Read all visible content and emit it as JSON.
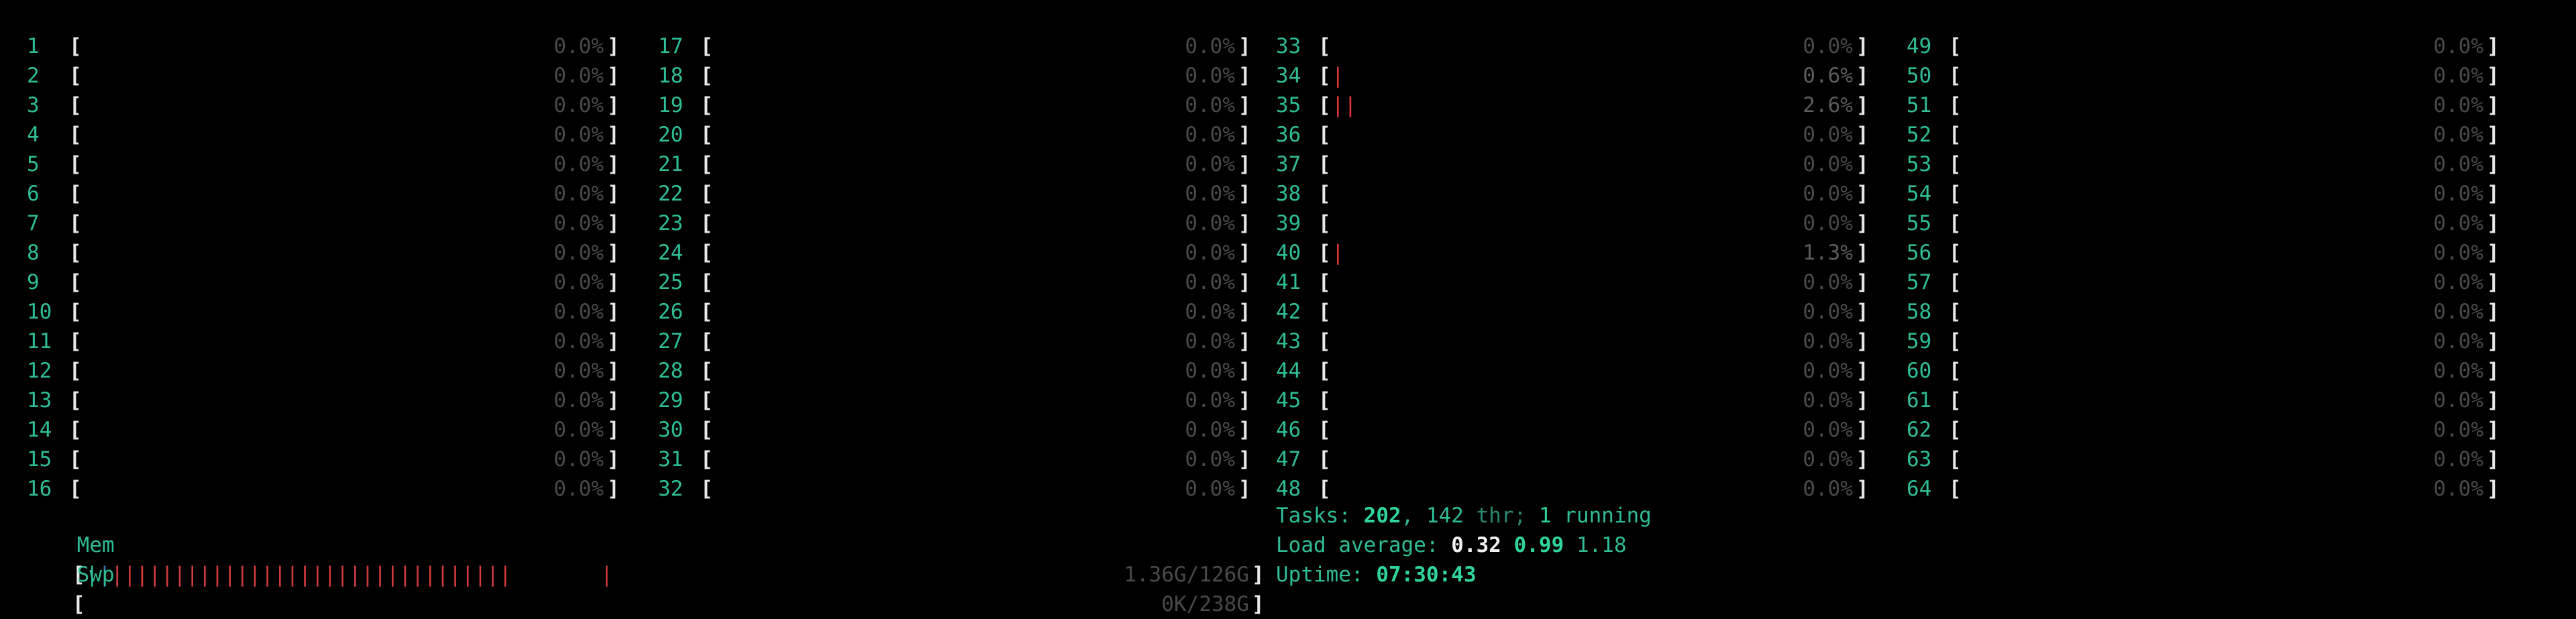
{
  "cpus": [
    {
      "id": "1",
      "pct": "0.0%",
      "bar": ""
    },
    {
      "id": "2",
      "pct": "0.0%",
      "bar": ""
    },
    {
      "id": "3",
      "pct": "0.0%",
      "bar": ""
    },
    {
      "id": "4",
      "pct": "0.0%",
      "bar": ""
    },
    {
      "id": "5",
      "pct": "0.0%",
      "bar": ""
    },
    {
      "id": "6",
      "pct": "0.0%",
      "bar": ""
    },
    {
      "id": "7",
      "pct": "0.0%",
      "bar": ""
    },
    {
      "id": "8",
      "pct": "0.0%",
      "bar": ""
    },
    {
      "id": "9",
      "pct": "0.0%",
      "bar": ""
    },
    {
      "id": "10",
      "pct": "0.0%",
      "bar": ""
    },
    {
      "id": "11",
      "pct": "0.0%",
      "bar": ""
    },
    {
      "id": "12",
      "pct": "0.0%",
      "bar": ""
    },
    {
      "id": "13",
      "pct": "0.0%",
      "bar": ""
    },
    {
      "id": "14",
      "pct": "0.0%",
      "bar": ""
    },
    {
      "id": "15",
      "pct": "0.0%",
      "bar": ""
    },
    {
      "id": "16",
      "pct": "0.0%",
      "bar": ""
    },
    {
      "id": "17",
      "pct": "0.0%",
      "bar": ""
    },
    {
      "id": "18",
      "pct": "0.0%",
      "bar": ""
    },
    {
      "id": "19",
      "pct": "0.0%",
      "bar": ""
    },
    {
      "id": "20",
      "pct": "0.0%",
      "bar": ""
    },
    {
      "id": "21",
      "pct": "0.0%",
      "bar": ""
    },
    {
      "id": "22",
      "pct": "0.0%",
      "bar": ""
    },
    {
      "id": "23",
      "pct": "0.0%",
      "bar": ""
    },
    {
      "id": "24",
      "pct": "0.0%",
      "bar": ""
    },
    {
      "id": "25",
      "pct": "0.0%",
      "bar": ""
    },
    {
      "id": "26",
      "pct": "0.0%",
      "bar": ""
    },
    {
      "id": "27",
      "pct": "0.0%",
      "bar": ""
    },
    {
      "id": "28",
      "pct": "0.0%",
      "bar": ""
    },
    {
      "id": "29",
      "pct": "0.0%",
      "bar": ""
    },
    {
      "id": "30",
      "pct": "0.0%",
      "bar": ""
    },
    {
      "id": "31",
      "pct": "0.0%",
      "bar": ""
    },
    {
      "id": "32",
      "pct": "0.0%",
      "bar": ""
    },
    {
      "id": "33",
      "pct": "0.0%",
      "bar": ""
    },
    {
      "id": "34",
      "pct": "0.6%",
      "bar": "|"
    },
    {
      "id": "35",
      "pct": "2.6%",
      "bar": "||"
    },
    {
      "id": "36",
      "pct": "0.0%",
      "bar": ""
    },
    {
      "id": "37",
      "pct": "0.0%",
      "bar": ""
    },
    {
      "id": "38",
      "pct": "0.0%",
      "bar": ""
    },
    {
      "id": "39",
      "pct": "0.0%",
      "bar": ""
    },
    {
      "id": "40",
      "pct": "1.3%",
      "bar": "|"
    },
    {
      "id": "41",
      "pct": "0.0%",
      "bar": ""
    },
    {
      "id": "42",
      "pct": "0.0%",
      "bar": ""
    },
    {
      "id": "43",
      "pct": "0.0%",
      "bar": ""
    },
    {
      "id": "44",
      "pct": "0.0%",
      "bar": ""
    },
    {
      "id": "45",
      "pct": "0.0%",
      "bar": ""
    },
    {
      "id": "46",
      "pct": "0.0%",
      "bar": ""
    },
    {
      "id": "47",
      "pct": "0.0%",
      "bar": ""
    },
    {
      "id": "48",
      "pct": "0.0%",
      "bar": ""
    },
    {
      "id": "49",
      "pct": "0.0%",
      "bar": ""
    },
    {
      "id": "50",
      "pct": "0.0%",
      "bar": ""
    },
    {
      "id": "51",
      "pct": "0.0%",
      "bar": ""
    },
    {
      "id": "52",
      "pct": "0.0%",
      "bar": ""
    },
    {
      "id": "53",
      "pct": "0.0%",
      "bar": ""
    },
    {
      "id": "54",
      "pct": "0.0%",
      "bar": ""
    },
    {
      "id": "55",
      "pct": "0.0%",
      "bar": ""
    },
    {
      "id": "56",
      "pct": "0.0%",
      "bar": ""
    },
    {
      "id": "57",
      "pct": "0.0%",
      "bar": ""
    },
    {
      "id": "58",
      "pct": "0.0%",
      "bar": ""
    },
    {
      "id": "59",
      "pct": "0.0%",
      "bar": ""
    },
    {
      "id": "60",
      "pct": "0.0%",
      "bar": ""
    },
    {
      "id": "61",
      "pct": "0.0%",
      "bar": ""
    },
    {
      "id": "62",
      "pct": "0.0%",
      "bar": ""
    },
    {
      "id": "63",
      "pct": "0.0%",
      "bar": ""
    },
    {
      "id": "64",
      "pct": "0.0%",
      "bar": ""
    }
  ],
  "brackets": {
    "open": "[",
    "close": "]"
  },
  "mem": {
    "label": "Mem",
    "bar_green": "|",
    "bar_blue": "|",
    "bar_red": "||||||||||||||||||||||||||||||||",
    "value": "1.36G/126G"
  },
  "swp": {
    "label": "Swp",
    "value": "0K/238G"
  },
  "tasks": {
    "label": "Tasks: ",
    "count": "202",
    "sep1": ", ",
    "threads": "142",
    "thr_label": " thr; ",
    "running": "1",
    "running_label": " running"
  },
  "load": {
    "label": "Load average: ",
    "one": "0.32",
    "five": "0.99",
    "fifteen": "1.18"
  },
  "uptime": {
    "label": "Uptime: ",
    "value": "07:30:43"
  },
  "colors": {
    "cyan": "#2fbd96",
    "red": "#d23b3b",
    "blue": "#3a7abf",
    "dim": "#4a4a4a",
    "bracket": "#e8e8e8"
  }
}
